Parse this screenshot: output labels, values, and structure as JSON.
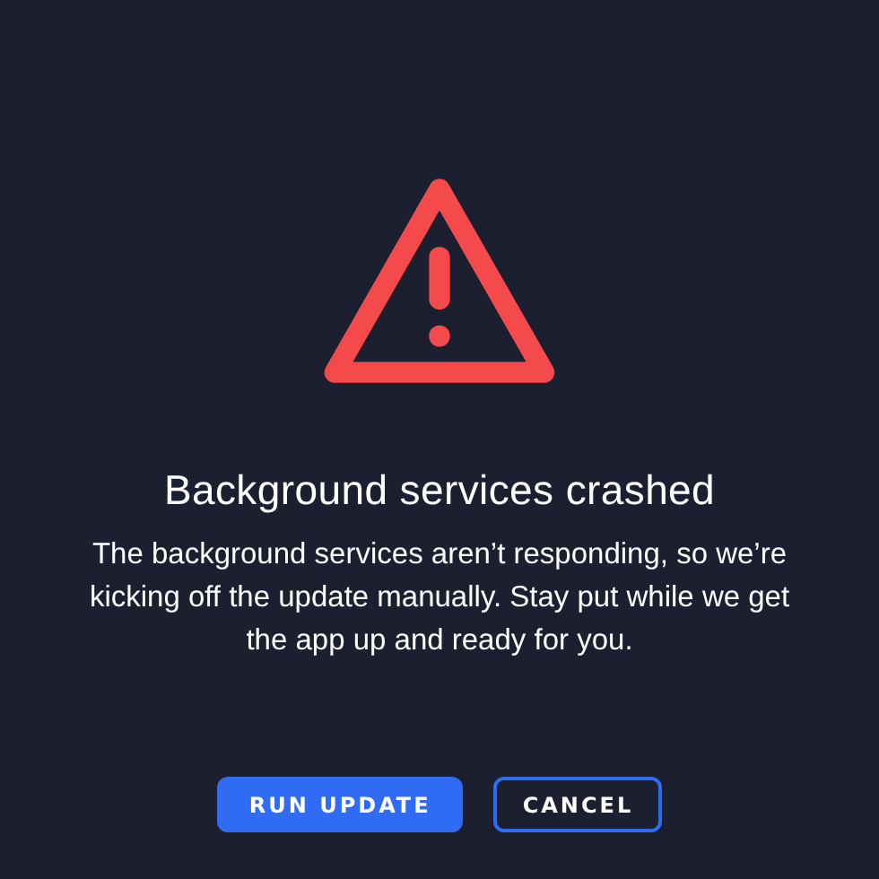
{
  "dialog": {
    "title": "Background services crashed",
    "message": "The background services aren’t responding, so we’re kicking off the update manually. Stay put while we get the app up and ready for you.",
    "buttons": [
      {
        "label": "RUN UPDATE",
        "kind": "primary"
      },
      {
        "label": "CANCEL",
        "kind": "secondary"
      }
    ]
  }
}
